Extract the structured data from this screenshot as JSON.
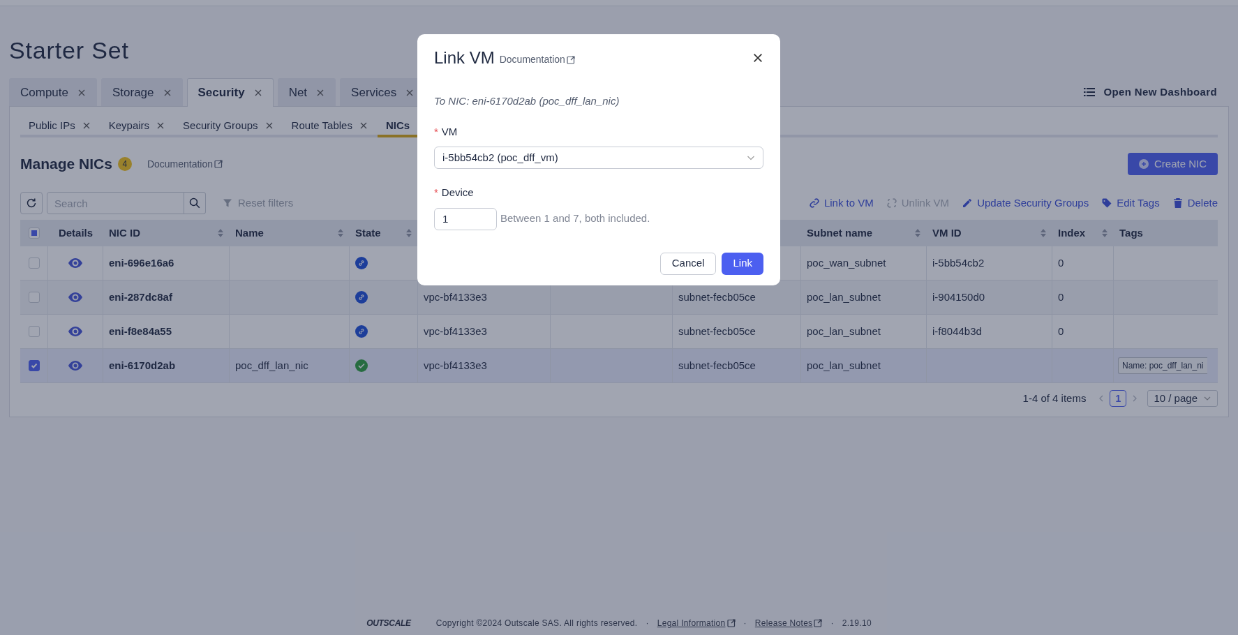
{
  "page": {
    "title": "Starter Set"
  },
  "tabs": [
    {
      "label": "Compute",
      "selected": false
    },
    {
      "label": "Storage",
      "selected": false
    },
    {
      "label": "Security",
      "selected": true
    },
    {
      "label": "Net",
      "selected": false
    },
    {
      "label": "Services",
      "selected": false
    }
  ],
  "open_dashboard": "Open New Dashboard",
  "subtabs": [
    {
      "label": "Public IPs",
      "selected": false
    },
    {
      "label": "Keypairs",
      "selected": false
    },
    {
      "label": "Security Groups",
      "selected": false
    },
    {
      "label": "Route Tables",
      "selected": false
    },
    {
      "label": "NICs",
      "selected": true
    }
  ],
  "header": {
    "title": "Manage NICs",
    "count": "4",
    "documentation": "Documentation",
    "create_button": "Create NIC"
  },
  "toolbar": {
    "search_placeholder": "Search",
    "reset_filters": "Reset filters",
    "actions": [
      {
        "kind": "link",
        "label": "Link to VM",
        "disabled": false
      },
      {
        "kind": "unlink",
        "label": "Unlink VM",
        "disabled": true
      },
      {
        "kind": "edit",
        "label": "Update Security Groups",
        "disabled": false
      },
      {
        "kind": "tag",
        "label": "Edit Tags",
        "disabled": false
      },
      {
        "kind": "delete",
        "label": "Delete",
        "disabled": false
      }
    ]
  },
  "table": {
    "select_all_partial": true,
    "columns": [
      {
        "label": "Details",
        "sortable": false
      },
      {
        "label": "NIC ID",
        "sortable": true
      },
      {
        "label": "Name",
        "sortable": true
      },
      {
        "label": "State",
        "sortable": true
      },
      {
        "label": "Subnet name",
        "sortable": true
      },
      {
        "label": "VM ID",
        "sortable": true
      },
      {
        "label": "Index",
        "sortable": true
      },
      {
        "label": "Tags",
        "sortable": false
      }
    ],
    "rows": [
      {
        "selected": false,
        "nic_id": "eni-696e16a6",
        "state": {
          "kind": "linked"
        },
        "subnet_name": "poc_wan_subnet",
        "vm_id": "i-5bb54cb2",
        "index": "0"
      },
      {
        "selected": false,
        "nic_id": "eni-287dc8af",
        "state": {
          "kind": "linked"
        },
        "vpc_id": "vpc-bf4133e3",
        "subnet_id": "subnet-fecb05ce",
        "subnet_name": "poc_lan_subnet",
        "vm_id": "i-904150d0",
        "index": "0"
      },
      {
        "selected": false,
        "nic_id": "eni-f8e84a55",
        "state": {
          "kind": "linked"
        },
        "vpc_id": "vpc-bf4133e3",
        "subnet_id": "subnet-fecb05ce",
        "subnet_name": "poc_lan_subnet",
        "vm_id": "i-f8044b3d",
        "index": "0"
      },
      {
        "selected": true,
        "nic_id": "eni-6170d2ab",
        "name": "poc_dff_lan_nic",
        "state": {
          "kind": "available"
        },
        "vpc_id": "vpc-bf4133e3",
        "subnet_id": "subnet-fecb05ce",
        "subnet_name": "poc_lan_subnet",
        "tags": [
          "Name: poc_dff_lan_ni"
        ]
      }
    ]
  },
  "pagination": {
    "summary": "1-4 of 4 items",
    "pages": [
      {
        "label": "1",
        "selected": true
      }
    ],
    "page_size": "10 / page"
  },
  "footer": {
    "logo": "OUTSCALE",
    "copyright": "Copyright ©2024 Outscale SAS. All rights reserved.",
    "separators": [
      "·",
      "·",
      "·"
    ],
    "links": [
      "Legal Information",
      "Release Notes"
    ],
    "version": "2.19.10"
  },
  "modal": {
    "title": "Link VM",
    "documentation": "Documentation",
    "target": "To NIC: eni-6170d2ab (poc_dff_lan_nic)",
    "fields": [
      {
        "kind": "select",
        "label": "VM",
        "required_mark": "*",
        "value": "i-5bb54cb2 (poc_dff_vm)"
      },
      {
        "kind": "number",
        "label": "Device",
        "required_mark": "*",
        "value": "1",
        "hint": "Between 1 and 7, both included."
      }
    ],
    "buttons": [
      {
        "kind": "secondary",
        "label": "Cancel"
      },
      {
        "kind": "primary",
        "label": "Link"
      }
    ]
  }
}
